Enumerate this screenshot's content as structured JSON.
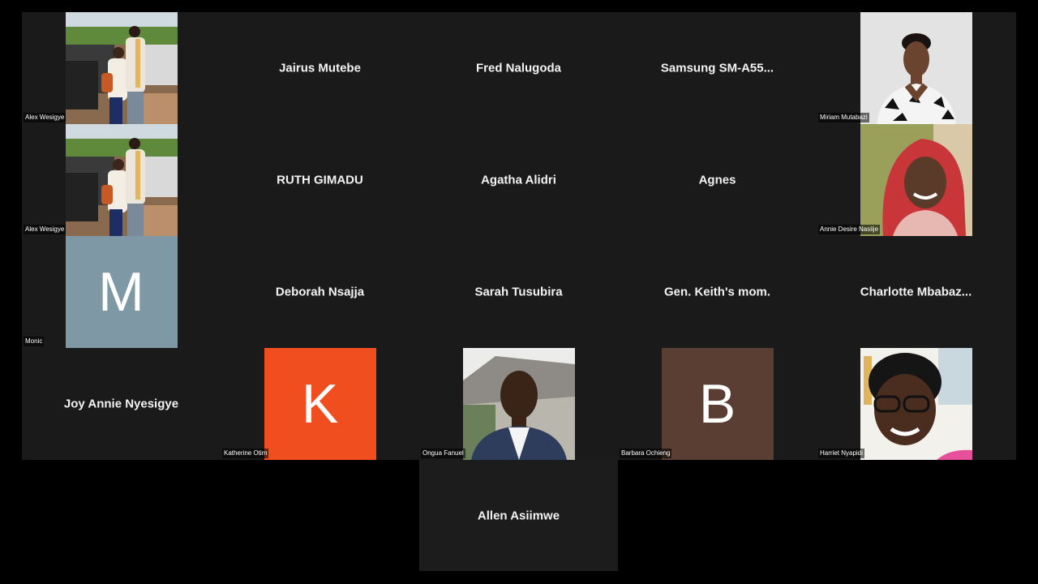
{
  "tiles": [
    {
      "id": "alex-1",
      "type": "video",
      "label": "Alex Wesigye",
      "photo": "couple-photo"
    },
    {
      "id": "jairus",
      "type": "name",
      "name": "Jairus Mutebe"
    },
    {
      "id": "fred",
      "type": "name",
      "name": "Fred Nalugoda"
    },
    {
      "id": "samsung",
      "type": "name",
      "name": "Samsung  SM-A55..."
    },
    {
      "id": "miriam",
      "type": "video",
      "label": "Miriam Mutabazi",
      "photo": "woman-portrait"
    },
    {
      "id": "alex-2",
      "type": "video",
      "label": "Alex Wesigye",
      "photo": "couple-photo"
    },
    {
      "id": "ruth",
      "type": "name",
      "name": "RUTH GIMADU"
    },
    {
      "id": "agatha",
      "type": "name",
      "name": "Agatha Alidri"
    },
    {
      "id": "agnes",
      "type": "name",
      "name": "Agnes"
    },
    {
      "id": "annie",
      "type": "video",
      "label": "Annie Desire Nasiije",
      "photo": "woman-red-braids"
    },
    {
      "id": "monic",
      "type": "avatar",
      "label": "Monic",
      "letter": "M",
      "color": "#7e98a6"
    },
    {
      "id": "deborah",
      "type": "name",
      "name": "Deborah Nsajja"
    },
    {
      "id": "sarah",
      "type": "name",
      "name": "Sarah Tusubira"
    },
    {
      "id": "keith",
      "type": "name",
      "name": "Gen. Keith's mom."
    },
    {
      "id": "charlotte",
      "type": "name",
      "name": "Charlotte  Mbabaz..."
    },
    {
      "id": "joy",
      "type": "name",
      "name": "Joy Annie Nyesigye"
    },
    {
      "id": "katherine",
      "type": "avatar",
      "label": "Katherine Otim",
      "letter": "K",
      "color": "#f04e1f"
    },
    {
      "id": "ongua",
      "type": "video",
      "label": "Ongua Fanuel",
      "photo": "man-portrait"
    },
    {
      "id": "barbara",
      "type": "avatar",
      "label": "Barbara Ochieng",
      "letter": "B",
      "color": "#5a3d33"
    },
    {
      "id": "harriet",
      "type": "video",
      "label": "Harriet Nyapidi",
      "photo": "woman-glasses"
    },
    {
      "id": "allen",
      "type": "name",
      "name": "Allen Asiimwe"
    }
  ],
  "colors": {
    "background": "#000000",
    "tile": "#1a1a1a",
    "text": "#f2f2f2"
  }
}
